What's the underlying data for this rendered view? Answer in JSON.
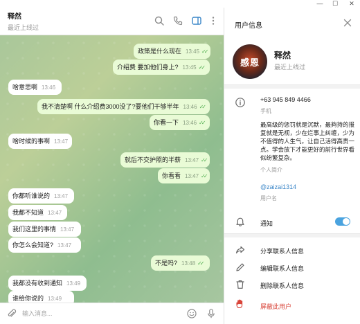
{
  "chat": {
    "name": "释然",
    "status": "最近上线过",
    "input_placeholder": "输入消息..."
  },
  "messages": [
    {
      "text": "政策是什么现在",
      "time": "13:45",
      "dir": "out"
    },
    {
      "text": "介绍费 要加他们身上?",
      "time": "13:45",
      "dir": "out"
    },
    {
      "text": "啥意思啊",
      "time": "13:46",
      "dir": "in"
    },
    {
      "text": "我不清楚啊 什么介绍费3000没了?要他们干够半年",
      "time": "13:46",
      "dir": "out"
    },
    {
      "text": "你看一下",
      "time": "13:46",
      "dir": "out"
    },
    {
      "text": "啥时候的事啊",
      "time": "13:47",
      "dir": "in"
    },
    {
      "text": "就后不交护照的半薪",
      "time": "13:47",
      "dir": "out"
    },
    {
      "text": "你看看",
      "time": "13:47",
      "dir": "out"
    },
    {
      "text": "你都听谁说的",
      "time": "13:47",
      "dir": "in"
    },
    {
      "text": "我都不知道",
      "time": "13:47",
      "dir": "in"
    },
    {
      "text": "我们这里的事情",
      "time": "13:47",
      "dir": "in"
    },
    {
      "text": "你怎么会知道?",
      "time": "13:47",
      "dir": "in"
    },
    {
      "text": "不是吗?",
      "time": "13:48",
      "dir": "out"
    },
    {
      "text": "我都没有收到通知",
      "time": "13:49",
      "dir": "in"
    },
    {
      "text": "谁给你说的",
      "time": "13:49",
      "dir": "in"
    }
  ],
  "info": {
    "title": "用户信息",
    "avatar_text": "感恩",
    "name": "释然",
    "status": "最近上线过",
    "phone": "+63 945 849 4466",
    "phone_label": "手机",
    "bio": "最高级的惩罚就是沉默，最夠持的报复就是无视，少在烂事上纠缠，少为不值得的人生气，让自己活得高贵一点。学会放下才能更好的前行世界看似纷繁复杂。",
    "bio_label": "个人简介",
    "username": "@zaizai1314",
    "username_label": "用户名",
    "notify_label": "通知",
    "notify_on": true,
    "actions": {
      "share": "分享联系人信息",
      "edit": "编辑联系人信息",
      "delete": "删除联系人信息",
      "block": "屏蔽此用户"
    }
  },
  "colors": {
    "accent": "#4aa3df",
    "outgoing_bubble": "#e9fbd6",
    "incoming_bubble": "#ffffff",
    "read_check": "#4fae4e",
    "danger": "#d9453a"
  }
}
